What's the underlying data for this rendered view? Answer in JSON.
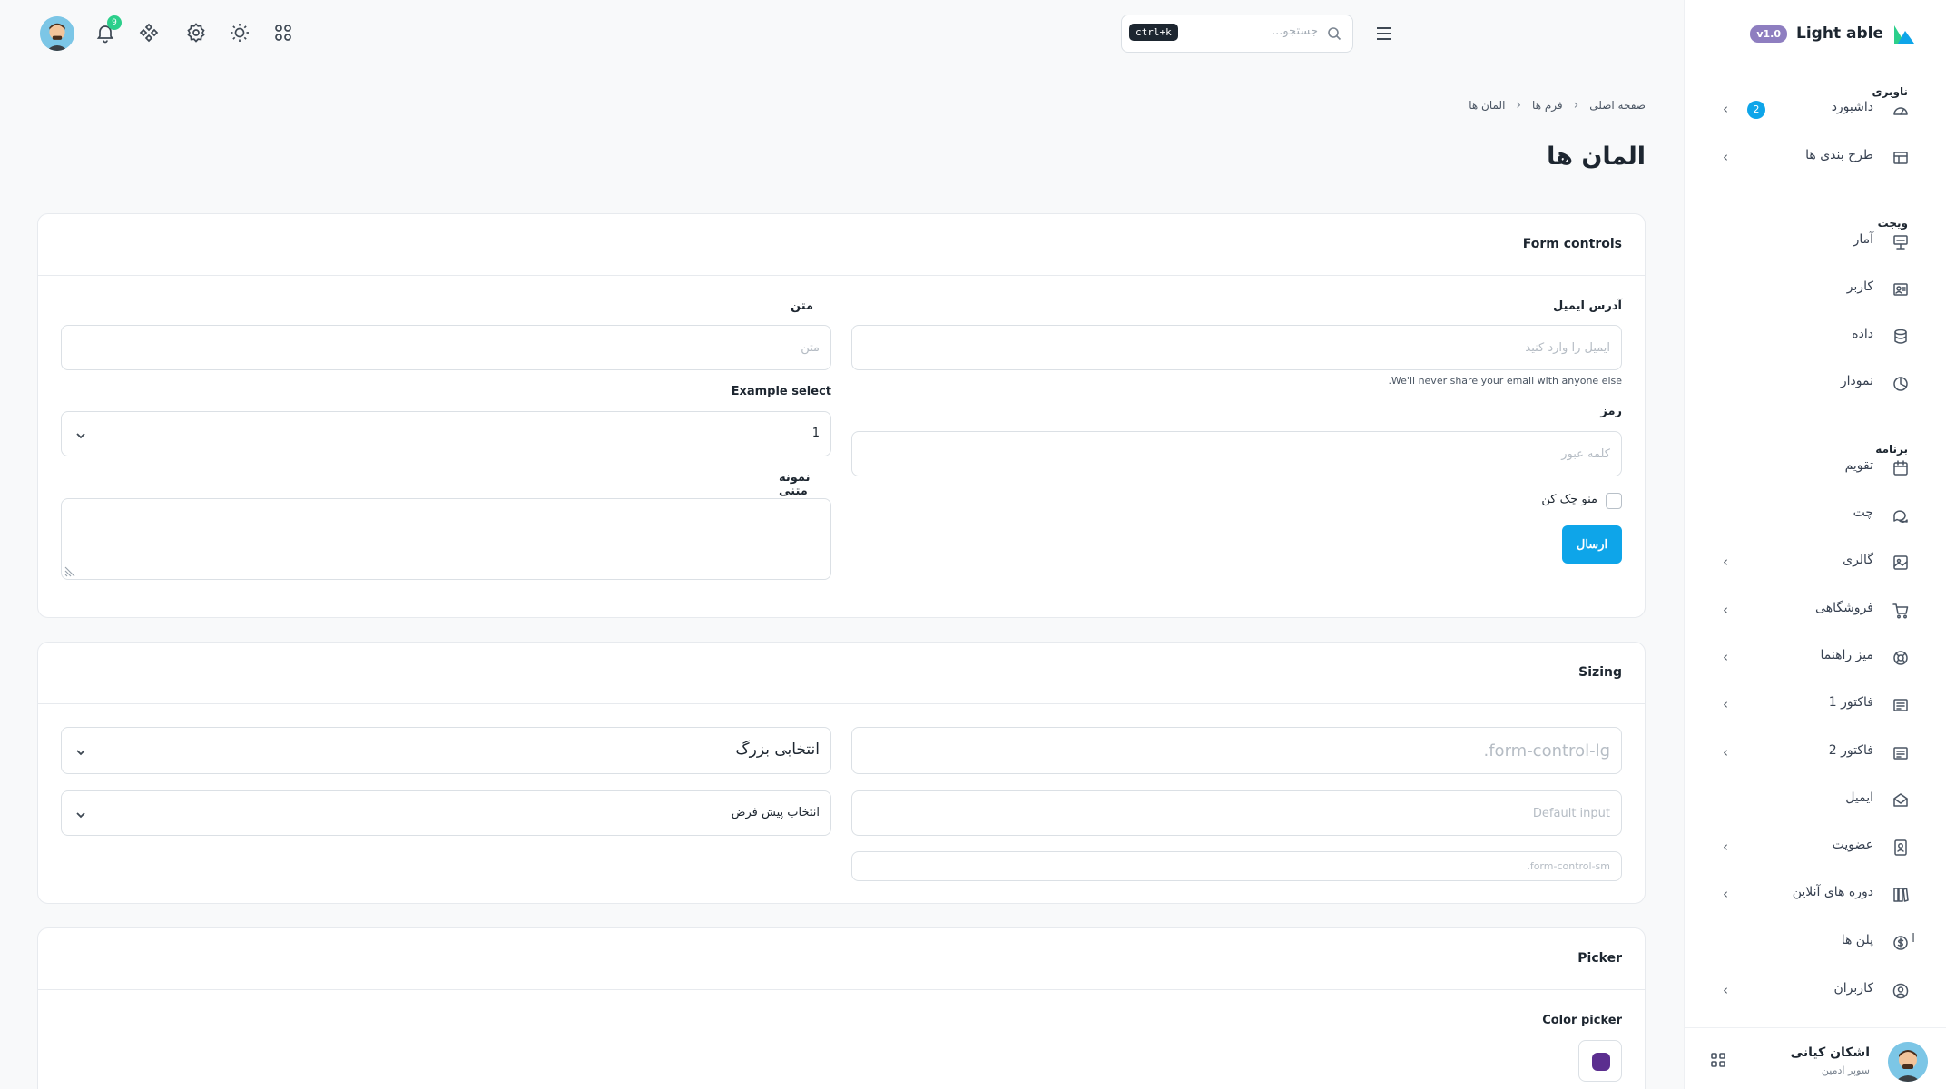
{
  "brand": {
    "name": "Light able",
    "version": "v1.0"
  },
  "sidebar": {
    "captions": [
      "ناوبری",
      "ویجت",
      "برنامه"
    ],
    "items": [
      {
        "label": "داشبورد",
        "icon": "dashboard-icon",
        "badge": "2",
        "chevron": true
      },
      {
        "label": "طرح بندی ها",
        "icon": "layout-icon",
        "chevron": true
      },
      {
        "label": "آمار",
        "icon": "statistics-icon"
      },
      {
        "label": "کاربر",
        "icon": "user-card-icon"
      },
      {
        "label": "داده",
        "icon": "database-icon"
      },
      {
        "label": "نمودار",
        "icon": "chart-pie-icon"
      },
      {
        "label": "تقویم",
        "icon": "calendar-icon"
      },
      {
        "label": "چت",
        "icon": "chat-icon"
      },
      {
        "label": "گالری",
        "icon": "gallery-icon",
        "chevron": true
      },
      {
        "label": "فروشگاهی",
        "icon": "cart-icon",
        "chevron": true
      },
      {
        "label": "میز راهنما",
        "icon": "lifebuoy-icon",
        "chevron": true
      },
      {
        "label": "فاکتور 1",
        "icon": "invoice-icon",
        "chevron": true
      },
      {
        "label": "فاکتور 2",
        "icon": "invoice-icon",
        "chevron": true
      },
      {
        "label": "ایمیل",
        "icon": "mail-icon"
      },
      {
        "label": "عضویت",
        "icon": "membership-icon",
        "chevron": true
      },
      {
        "label": "دوره های آنلاین",
        "icon": "books-icon",
        "chevron": true
      },
      {
        "label": "پلن ها",
        "icon": "dollar-circle-icon",
        "marker": "I"
      },
      {
        "label": "کاربران",
        "icon": "user-circle-icon",
        "chevron": true
      }
    ],
    "footer": {
      "name": "اشکان کیانی",
      "role": "سوپر ادمین"
    }
  },
  "header": {
    "search_placeholder": "جستجو...",
    "shortcut": "ctrl+k",
    "notification_count": "9"
  },
  "breadcrumb": [
    "صفحه اصلی",
    "فرم ها",
    "المان ها"
  ],
  "page_title": "المان ها",
  "form_controls": {
    "title": "Form controls",
    "email_label": "آدرس ایمیل",
    "email_placeholder": "ایمیل را وارد کنید",
    "email_help": ".We'll never share your email with anyone else",
    "password_label": "رمز",
    "password_placeholder": "کلمه عبور",
    "check_label": "منو چک کن",
    "submit_label": "ارسال",
    "text_label": "متن",
    "text_placeholder": "متن",
    "select_label": "Example select",
    "select_value": "1",
    "textarea_label": "نمونه متنی"
  },
  "sizing": {
    "title": "Sizing",
    "lg_placeholder": ".form-control-lg",
    "default_placeholder": "Default input",
    "sm_placeholder": ".form-control-sm",
    "select_lg": "انتخابی بزرگ",
    "select_default": "انتخاب پیش فرض"
  },
  "picker": {
    "title": "Picker",
    "color_label": "Color picker",
    "color_value": "#5b2e8f"
  },
  "colors": {
    "primary": "#0ea5e9",
    "brand_badge": "#8e7ec0",
    "bell_badge": "#2ccf8b"
  }
}
